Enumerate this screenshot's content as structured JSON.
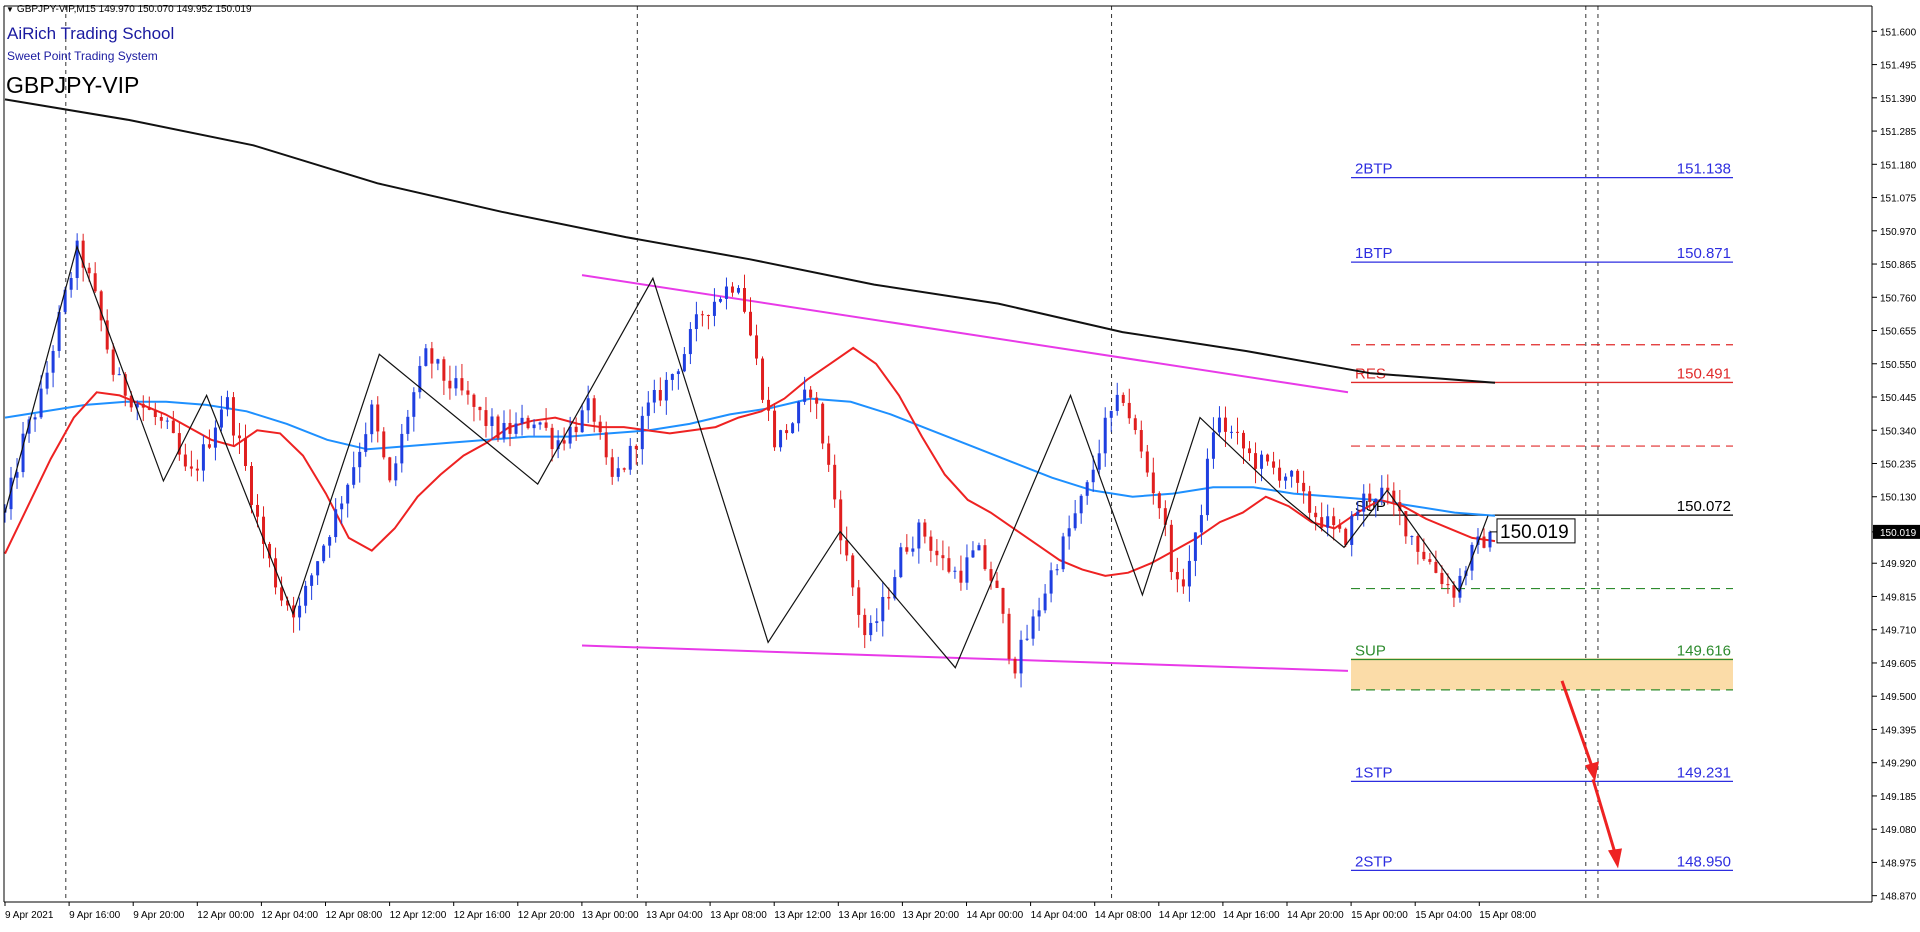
{
  "header": {
    "info": "GBPJPY-VIP,M15  149.970 150.070 149.952 150.019",
    "school": "AiRich Trading School",
    "system": "Sweet Point Trading System",
    "symbol": "GBPJPY-VIP"
  },
  "chart_data": {
    "type": "candlestick",
    "symbol": "GBPJPY-VIP",
    "timeframe": "M15",
    "ohlc": {
      "open": 149.97,
      "high": 150.07,
      "low": 149.952,
      "close": 150.019
    },
    "current_price_label": "150.019",
    "ylim": [
      148.85,
      151.68
    ],
    "y_ticks": [
      "151.600",
      "151.495",
      "151.390",
      "151.285",
      "151.180",
      "151.075",
      "150.970",
      "150.865",
      "150.760",
      "150.655",
      "150.550",
      "150.445",
      "150.340",
      "150.235",
      "150.130",
      "150.019",
      "149.920",
      "149.815",
      "149.710",
      "149.605",
      "149.500",
      "149.395",
      "149.290",
      "149.185",
      "149.080",
      "148.975",
      "148.870"
    ],
    "x_ticks": [
      "9 Apr 2021",
      "9 Apr 16:00",
      "9 Apr 20:00",
      "12 Apr 00:00",
      "12 Apr 04:00",
      "12 Apr 08:00",
      "12 Apr 12:00",
      "12 Apr 16:00",
      "12 Apr 20:00",
      "13 Apr 00:00",
      "13 Apr 04:00",
      "13 Apr 08:00",
      "13 Apr 12:00",
      "13 Apr 16:00",
      "13 Apr 20:00",
      "14 Apr 00:00",
      "14 Apr 04:00",
      "14 Apr 08:00",
      "14 Apr 12:00",
      "14 Apr 16:00",
      "14 Apr 20:00",
      "15 Apr 00:00",
      "15 Apr 04:00",
      "15 Apr 08:00"
    ],
    "price_path": [
      150.08,
      150.31,
      150.45,
      150.7,
      150.92,
      150.74,
      150.5,
      150.44,
      150.39,
      150.33,
      150.18,
      150.29,
      150.45,
      150.25,
      150.0,
      149.82,
      149.76,
      149.93,
      150.07,
      150.23,
      150.4,
      150.16,
      150.4,
      150.58,
      150.5,
      150.45,
      150.38,
      150.33,
      150.35,
      150.38,
      150.3,
      150.35,
      150.42,
      150.17,
      150.25,
      150.4,
      150.48,
      150.58,
      150.71,
      150.77,
      150.82,
      150.55,
      150.3,
      150.37,
      150.48,
      150.2,
      149.9,
      149.67,
      149.8,
      149.97,
      150.03,
      149.93,
      149.88,
      149.96,
      149.85,
      149.59,
      149.72,
      149.88,
      150.02,
      150.15,
      150.35,
      150.45,
      150.26,
      150.1,
      149.82,
      150.0,
      150.38,
      150.32,
      150.25,
      150.22,
      150.2,
      150.1,
      150.05,
      149.99,
      150.12,
      150.15,
      150.08,
      149.98,
      149.9,
      149.83,
      149.95,
      150.019
    ],
    "red_ma": [
      149.95,
      150.1,
      150.25,
      150.38,
      150.46,
      150.45,
      150.42,
      150.39,
      150.35,
      150.31,
      150.29,
      150.34,
      150.33,
      150.26,
      150.14,
      150.0,
      149.96,
      150.03,
      150.13,
      150.2,
      150.26,
      150.3,
      150.35,
      150.37,
      150.38,
      150.36,
      150.35,
      150.35,
      150.34,
      150.33,
      150.34,
      150.35,
      150.38,
      150.4,
      150.44,
      150.5,
      150.55,
      150.6,
      150.55,
      150.45,
      150.32,
      150.2,
      150.12,
      150.08,
      150.03,
      149.98,
      149.93,
      149.9,
      149.88,
      149.89,
      149.92,
      149.96,
      150.0,
      150.05,
      150.08,
      150.13,
      150.1,
      150.05,
      150.03,
      150.08,
      150.12,
      150.1,
      150.06,
      150.03,
      150.0,
      149.99
    ],
    "blue_ma": [
      150.38,
      150.4,
      150.42,
      150.43,
      150.43,
      150.42,
      150.4,
      150.36,
      150.31,
      150.28,
      150.29,
      150.3,
      150.31,
      150.32,
      150.32,
      150.33,
      150.34,
      150.36,
      150.39,
      150.41,
      150.44,
      150.43,
      150.39,
      150.34,
      150.29,
      150.24,
      150.19,
      150.15,
      150.13,
      150.14,
      150.16,
      150.16,
      150.14,
      150.13,
      150.12,
      150.1,
      150.08,
      150.07
    ],
    "black_ma": [
      151.385,
      151.32,
      151.24,
      151.12,
      151.03,
      150.95,
      150.88,
      150.8,
      150.74,
      150.65,
      150.59,
      150.52,
      150.49
    ],
    "zigzag": [
      [
        150.08,
        0
      ],
      [
        150.92,
        5
      ],
      [
        150.18,
        11
      ],
      [
        150.45,
        14
      ],
      [
        149.76,
        20
      ],
      [
        150.58,
        26
      ],
      [
        150.17,
        37
      ],
      [
        150.82,
        45
      ],
      [
        149.67,
        53
      ],
      [
        150.02,
        58
      ],
      [
        149.59,
        66
      ],
      [
        150.45,
        74
      ],
      [
        149.82,
        79
      ],
      [
        150.38,
        83
      ],
      [
        150.12,
        89
      ],
      [
        149.97,
        93
      ],
      [
        150.15,
        96
      ],
      [
        149.83,
        101
      ],
      [
        150.07,
        103
      ]
    ],
    "levels": [
      {
        "label": "2BTP",
        "value": "151.138",
        "color": "#2d2de0"
      },
      {
        "label": "1BTP",
        "value": "150.871",
        "color": "#2d2de0"
      },
      {
        "label": "RES",
        "value": "150.491",
        "color": "#e02a2a"
      },
      {
        "label": "SUP",
        "value": "150.072",
        "color": "#000000"
      },
      {
        "label": "SUP",
        "value": "149.616",
        "color": "#2e8b2e"
      },
      {
        "label": "1STP",
        "value": "149.231",
        "color": "#2d2de0"
      },
      {
        "label": "2STP",
        "value": "148.950",
        "color": "#2d2de0"
      }
    ],
    "dashed_levels": {
      "red": [
        150.61,
        150.29
      ],
      "green": [
        149.84,
        149.52
      ]
    },
    "sup_zone": [
      149.52,
      149.62
    ],
    "channel": {
      "upper": [
        150.83,
        150.46
      ],
      "lower": [
        149.66,
        149.58
      ]
    },
    "arrow_targets": [
      149.231,
      148.95
    ],
    "colors": {
      "bull": "#1f3fe0",
      "bear": "#e01f1f",
      "red_ma": "#ee2222",
      "blue_ma": "#1e90ff",
      "black_ma": "#111111",
      "channel": "#e83ae8",
      "zone": "#fbdca8",
      "arrow": "#ee2222"
    }
  }
}
